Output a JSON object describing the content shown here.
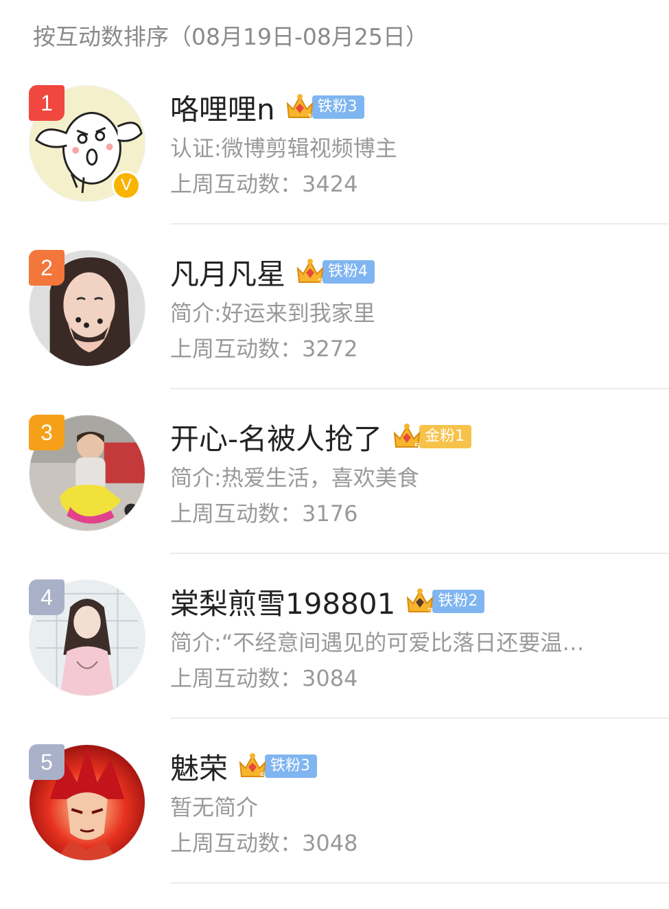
{
  "header": {
    "title": "按互动数排序（08月19日-08月25日）"
  },
  "colors": {
    "rank_1": "#f0483e",
    "rank_2": "#f3763b",
    "rank_3": "#f6a01a",
    "rank_other": "#a9b1c9",
    "fan_iron": "#7fb5f0",
    "fan_gold": "#f7c24a"
  },
  "fans": [
    {
      "rank": "1",
      "name": "咯哩哩n",
      "crown_level": "1",
      "fan_label": "铁粉3",
      "fan_type": "iron",
      "intro": "认证:微博剪辑视频博主",
      "count_label": "上周互动数：",
      "count": "3424",
      "verified": true,
      "avatar": "sheep-cartoon-avatar"
    },
    {
      "rank": "2",
      "name": "凡月凡星",
      "crown_level": "3",
      "fan_label": "铁粉4",
      "fan_type": "iron",
      "intro": "简介:好运来到我家里",
      "count_label": "上周互动数：",
      "count": "3272",
      "verified": false,
      "avatar": "woman-portrait-avatar"
    },
    {
      "rank": "3",
      "name": "开心-名被人抢了",
      "crown_level": "5",
      "fan_label": "金粉1",
      "fan_type": "gold",
      "intro": "简介:热爱生活，喜欢美食",
      "count_label": "上周互动数：",
      "count": "3176",
      "verified": false,
      "avatar": "child-on-toy-avatar"
    },
    {
      "rank": "4",
      "name": "棠梨煎雪198801",
      "crown_level": "3",
      "fan_label": "铁粉2",
      "fan_type": "iron",
      "intro": "简介:“不经意间遇见的可爱比落日还要温…",
      "count_label": "上周互动数：",
      "count": "3084",
      "verified": false,
      "avatar": "girl-pink-sweater-avatar"
    },
    {
      "rank": "5",
      "name": "魅荣",
      "crown_level": "5",
      "fan_label": "铁粉3",
      "fan_type": "iron",
      "intro": "暂无简介",
      "count_label": "上周互动数：",
      "count": "3048",
      "verified": false,
      "avatar": "anime-warrior-avatar"
    }
  ]
}
